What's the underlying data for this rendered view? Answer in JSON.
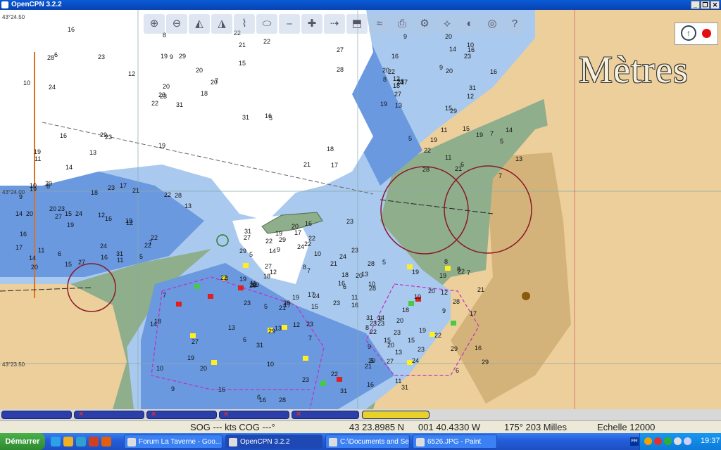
{
  "window": {
    "title": "OpenCPN 3.2.2",
    "buttons": [
      "_",
      "❐",
      "✕"
    ]
  },
  "chart": {
    "units_label": "Mètres",
    "lat_labels": [
      "43°24.50",
      "43°24.00",
      "43°23.50"
    ],
    "depth_soundings": [
      "31",
      "28",
      "23",
      "19",
      "20",
      "23",
      "22",
      "29",
      "21",
      "18",
      "16",
      "17",
      "24",
      "27",
      "22",
      "15",
      "14",
      "19",
      "20",
      "16",
      "12",
      "11",
      "13",
      "9",
      "7",
      "5",
      "6",
      "8",
      "10"
    ],
    "colors": {
      "deep": "#ffffff",
      "medium": "#a9c9ee",
      "shallow": "#6a99e0",
      "drying": "#8fae8c",
      "land": "#edcf9c",
      "built": "#d4b37a"
    }
  },
  "toolbar": {
    "icons": [
      "zoom-in-icon",
      "zoom-out-icon",
      "scale-in-icon",
      "scale-out-icon",
      "route-icon",
      "tide-icon",
      "measure-icon",
      "waypoint-icon",
      "track-icon",
      "ais-icon",
      "current-icon",
      "print-icon",
      "settings-icon",
      "route-manager-icon",
      "colorscheme-icon",
      "anchor-watch-icon",
      "help-icon"
    ],
    "glyphs": [
      "⊕",
      "⊖",
      "◭",
      "◮",
      "⌇",
      "⬭",
      "⎯",
      "✚",
      "⇢",
      "⬒",
      "≈",
      "⎙",
      "⚙",
      "⟡",
      "◐",
      "◎",
      "?"
    ]
  },
  "chartbar_buttons": [
    {
      "label": "",
      "color": "#2a3fa8",
      "has_x": false
    },
    {
      "label": "",
      "color": "#2a3fa8",
      "has_x": true
    },
    {
      "label": "",
      "color": "#2a3fa8",
      "has_x": true
    },
    {
      "label": "",
      "color": "#2a3fa8",
      "has_x": true
    },
    {
      "label": "",
      "color": "#2a3fa8",
      "has_x": true
    },
    {
      "label": "",
      "color": "#e8d22a",
      "has_x": false
    }
  ],
  "status": {
    "sog_cog": "SOG --- kts  COG ---°",
    "lat": "43 23.8985 N",
    "lon": "001 40.4330 W",
    "bearing_range": "175°  203 Milles",
    "scale": "Echelle 12000"
  },
  "taskbar": {
    "start_label": "Démarrer",
    "tasks": [
      {
        "label": "Forum La Taverne - Goo...",
        "active": false
      },
      {
        "label": "OpenCPN 3.2.2",
        "active": true
      },
      {
        "label": "C:\\Documents and Settin...",
        "active": false
      },
      {
        "label": "6526.JPG - Paint",
        "active": false
      }
    ],
    "lang": "FR",
    "clock": "19:37"
  }
}
